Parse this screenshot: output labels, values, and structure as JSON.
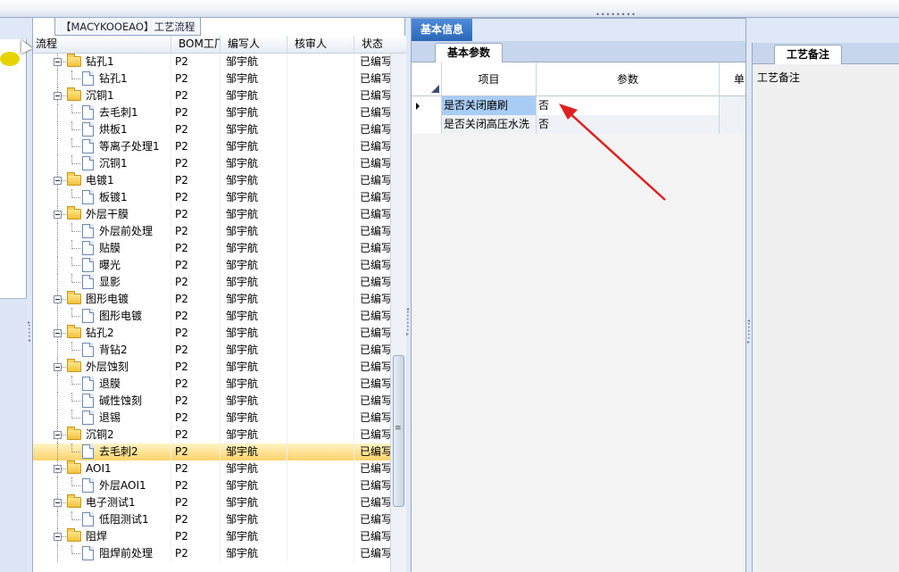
{
  "app": {
    "panel_title": "【MACYKOOEAO】工艺流程"
  },
  "tree": {
    "columns": [
      "流程",
      "BOM工厂",
      "编写人",
      "核审人",
      "状态"
    ],
    "rows": [
      {
        "label": "钻孔1",
        "type": "folder",
        "bom": "P2",
        "writer": "邹宇航",
        "reviewer": "",
        "status": "已编写"
      },
      {
        "label": "钻孔1",
        "type": "doc",
        "bom": "P2",
        "writer": "邹宇航",
        "reviewer": "",
        "status": "已编写"
      },
      {
        "label": "沉铜1",
        "type": "folder",
        "bom": "P2",
        "writer": "邹宇航",
        "reviewer": "",
        "status": "已编写"
      },
      {
        "label": "去毛刺1",
        "type": "doc",
        "bom": "P2",
        "writer": "邹宇航",
        "reviewer": "",
        "status": "已编写"
      },
      {
        "label": "烘板1",
        "type": "doc",
        "bom": "P2",
        "writer": "邹宇航",
        "reviewer": "",
        "status": "已编写"
      },
      {
        "label": "等离子处理1",
        "type": "doc",
        "bom": "P2",
        "writer": "邹宇航",
        "reviewer": "",
        "status": "已编写"
      },
      {
        "label": "沉铜1",
        "type": "doc",
        "bom": "P2",
        "writer": "邹宇航",
        "reviewer": "",
        "status": "已编写"
      },
      {
        "label": "电镀1",
        "type": "folder",
        "bom": "P2",
        "writer": "邹宇航",
        "reviewer": "",
        "status": "已编写"
      },
      {
        "label": "板镀1",
        "type": "doc",
        "bom": "P2",
        "writer": "邹宇航",
        "reviewer": "",
        "status": "已编写"
      },
      {
        "label": "外层干膜",
        "type": "folder",
        "bom": "P2",
        "writer": "邹宇航",
        "reviewer": "",
        "status": "已编写"
      },
      {
        "label": "外层前处理",
        "type": "doc",
        "bom": "P2",
        "writer": "邹宇航",
        "reviewer": "",
        "status": "已编写"
      },
      {
        "label": "贴膜",
        "type": "doc",
        "bom": "P2",
        "writer": "邹宇航",
        "reviewer": "",
        "status": "已编写"
      },
      {
        "label": "曝光",
        "type": "doc",
        "bom": "P2",
        "writer": "邹宇航",
        "reviewer": "",
        "status": "已编写"
      },
      {
        "label": "显影",
        "type": "doc",
        "bom": "P2",
        "writer": "邹宇航",
        "reviewer": "",
        "status": "已编写"
      },
      {
        "label": "图形电镀",
        "type": "folder",
        "bom": "P2",
        "writer": "邹宇航",
        "reviewer": "",
        "status": "已编写"
      },
      {
        "label": "图形电镀",
        "type": "doc",
        "bom": "P2",
        "writer": "邹宇航",
        "reviewer": "",
        "status": "已编写"
      },
      {
        "label": "钻孔2",
        "type": "folder",
        "bom": "P2",
        "writer": "邹宇航",
        "reviewer": "",
        "status": "已编写"
      },
      {
        "label": "背钻2",
        "type": "doc",
        "bom": "P2",
        "writer": "邹宇航",
        "reviewer": "",
        "status": "已编写"
      },
      {
        "label": "外层蚀刻",
        "type": "folder",
        "bom": "P2",
        "writer": "邹宇航",
        "reviewer": "",
        "status": "已编写"
      },
      {
        "label": "退膜",
        "type": "doc",
        "bom": "P2",
        "writer": "邹宇航",
        "reviewer": "",
        "status": "已编写"
      },
      {
        "label": "碱性蚀刻",
        "type": "doc",
        "bom": "P2",
        "writer": "邹宇航",
        "reviewer": "",
        "status": "已编写"
      },
      {
        "label": "退锡",
        "type": "doc",
        "bom": "P2",
        "writer": "邹宇航",
        "reviewer": "",
        "status": "已编写"
      },
      {
        "label": "沉铜2",
        "type": "folder",
        "bom": "P2",
        "writer": "邹宇航",
        "reviewer": "",
        "status": "已编写"
      },
      {
        "label": "去毛刺2",
        "type": "doc",
        "bom": "P2",
        "writer": "邹宇航",
        "reviewer": "",
        "status": "已编写",
        "selected": true
      },
      {
        "label": "AOI1",
        "type": "folder",
        "bom": "P2",
        "writer": "邹宇航",
        "reviewer": "",
        "status": "已编写"
      },
      {
        "label": "外层AOI1",
        "type": "doc",
        "bom": "P2",
        "writer": "邹宇航",
        "reviewer": "",
        "status": "已编写"
      },
      {
        "label": "电子测试1",
        "type": "folder",
        "bom": "P2",
        "writer": "邹宇航",
        "reviewer": "",
        "status": "已编写"
      },
      {
        "label": "低阻测试1",
        "type": "doc",
        "bom": "P2",
        "writer": "邹宇航",
        "reviewer": "",
        "status": "已编写"
      },
      {
        "label": "阻焊",
        "type": "folder",
        "bom": "P2",
        "writer": "邹宇航",
        "reviewer": "",
        "status": "已编写"
      },
      {
        "label": "阻焊前处理",
        "type": "doc",
        "bom": "P2",
        "writer": "邹宇航",
        "reviewer": "",
        "status": "已编写"
      }
    ]
  },
  "middle": {
    "main_tab": "基本信息",
    "sub_tab": "基本参数",
    "grid_columns": [
      "项目",
      "参数",
      "单"
    ],
    "grid_rows": [
      {
        "item": "是否关闭磨刷",
        "value": "否",
        "current": true
      },
      {
        "item": "是否关闭高压水洗",
        "value": "否",
        "current": false
      }
    ]
  },
  "right": {
    "tab": "工艺备注",
    "label": "工艺备注"
  },
  "colors": {
    "accent_blue": "#2c67b8",
    "selection": "#ffd36b",
    "annotation_arrow": "#e02020"
  }
}
